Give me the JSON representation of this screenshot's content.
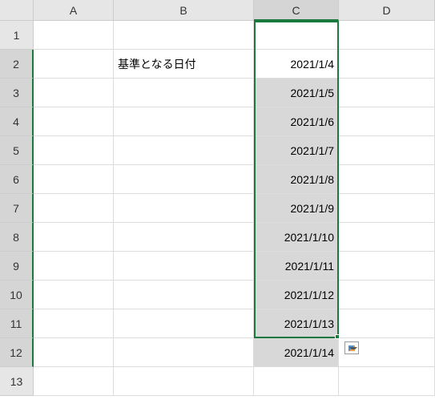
{
  "columns": [
    "A",
    "B",
    "C",
    "D"
  ],
  "rows": [
    "1",
    "2",
    "3",
    "4",
    "5",
    "6",
    "7",
    "8",
    "9",
    "10",
    "11",
    "12",
    "13"
  ],
  "activeColumn": "C",
  "activeRows": [
    "2",
    "3",
    "4",
    "5",
    "6",
    "7",
    "8",
    "9",
    "10",
    "11",
    "12"
  ],
  "cells": {
    "B2": "基準となる日付",
    "C2": "2021/1/4",
    "C3": "2021/1/5",
    "C4": "2021/1/6",
    "C5": "2021/1/7",
    "C6": "2021/1/8",
    "C7": "2021/1/9",
    "C8": "2021/1/10",
    "C9": "2021/1/11",
    "C10": "2021/1/12",
    "C11": "2021/1/13",
    "C12": "2021/1/14"
  }
}
